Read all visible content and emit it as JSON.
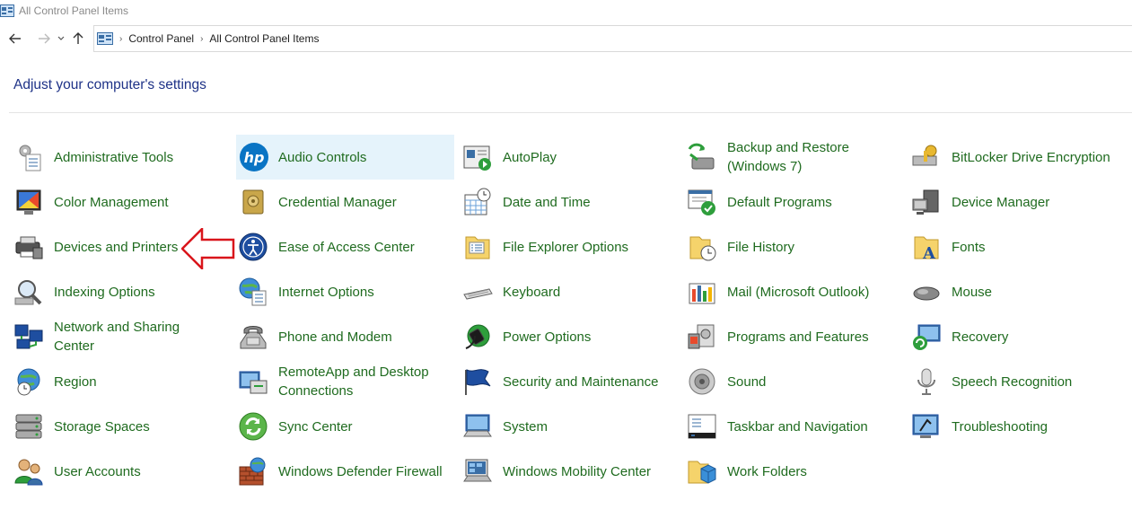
{
  "window": {
    "title": "All Control Panel Items"
  },
  "nav": {
    "back": "back",
    "forward": "forward",
    "recent": "recent",
    "up": "up"
  },
  "breadcrumb": [
    "Control Panel",
    "All Control Panel Items"
  ],
  "heading": "Adjust your computer's settings",
  "items": [
    "Administrative Tools",
    "Audio Controls",
    "AutoPlay",
    "Backup and Restore (Windows 7)",
    "BitLocker Drive Encryption",
    "Color Management",
    "Credential Manager",
    "Date and Time",
    "Default Programs",
    "Device Manager",
    "Devices and Printers",
    "Ease of Access Center",
    "File Explorer Options",
    "File History",
    "Fonts",
    "Indexing Options",
    "Internet Options",
    "Keyboard",
    "Mail (Microsoft Outlook)",
    "Mouse",
    "Network and Sharing Center",
    "Phone and Modem",
    "Power Options",
    "Programs and Features",
    "Recovery",
    "Region",
    "RemoteApp and Desktop Connections",
    "Security and Maintenance",
    "Sound",
    "Speech Recognition",
    "Storage Spaces",
    "Sync Center",
    "System",
    "Taskbar and Navigation",
    "Troubleshooting",
    "User Accounts",
    "Windows Defender Firewall",
    "Windows Mobility Center",
    "Work Folders"
  ],
  "colors": {
    "link": "#1f6b1f",
    "heading": "#1e3287",
    "hover": "#e5f3fb",
    "arrow": "#d9151b"
  }
}
